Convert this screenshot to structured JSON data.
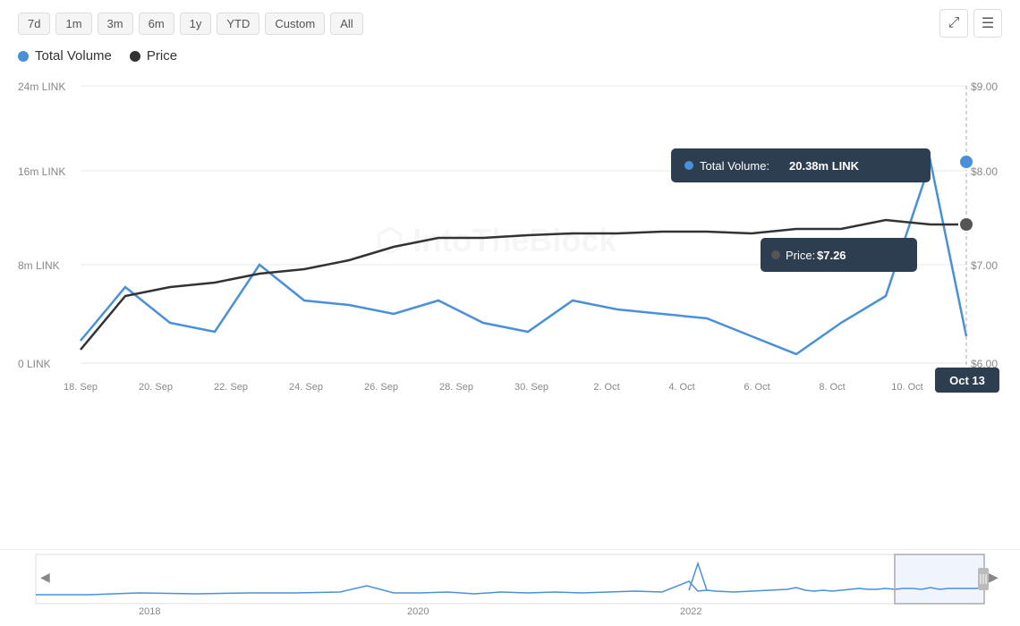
{
  "toolbar": {
    "buttons": [
      "7d",
      "1m",
      "3m",
      "6m",
      "1y",
      "YTD",
      "Custom",
      "All"
    ]
  },
  "legend": {
    "items": [
      {
        "label": "Total Volume",
        "color": "blue"
      },
      {
        "label": "Price",
        "color": "dark"
      }
    ]
  },
  "chart": {
    "y_axis_left": [
      "24m LINK",
      "16m LINK",
      "8m LINK",
      "0 LINK"
    ],
    "y_axis_right": [
      "$9.00",
      "$8.00",
      "$7.00",
      "$6.00"
    ],
    "x_axis": [
      "18. Sep",
      "20. Sep",
      "22. Sep",
      "24. Sep",
      "26. Sep",
      "28. Sep",
      "30. Sep",
      "2. Oct",
      "4. Oct",
      "6. Oct",
      "8. Oct",
      "10. Oct"
    ],
    "watermark": "IntoTheBlock"
  },
  "tooltips": {
    "volume_label": "Total Volume:",
    "volume_value": "20.38m LINK",
    "price_label": "Price:",
    "price_value": "$7.26",
    "date_label": "Oct 13"
  },
  "mini_chart": {
    "years": [
      "2018",
      "2020",
      "2022"
    ]
  }
}
